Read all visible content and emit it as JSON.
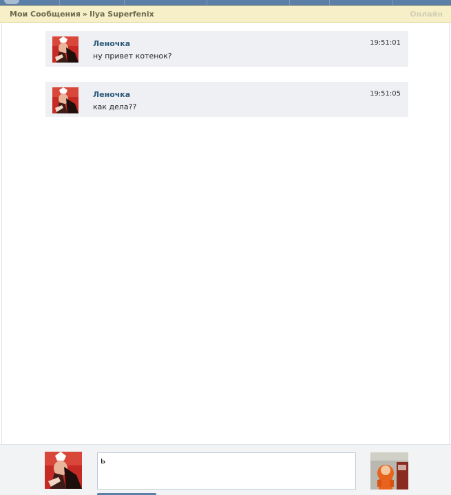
{
  "header": {
    "breadcrumb_root": "Мои Сообщения",
    "breadcrumb_separator": "»",
    "breadcrumb_current": "Ilya Superfenix",
    "status": "Онлайн"
  },
  "messages": [
    {
      "author": "Леночка",
      "time": "19:51:01",
      "text": "ну привет котенок?"
    },
    {
      "author": "Леночка",
      "time": "19:51:05",
      "text": "как дела??"
    }
  ],
  "composer": {
    "value": "ь"
  },
  "colors": {
    "header_bg": "#f7efc8",
    "author_link": "#2b587a",
    "message_bg": "#eef0f3",
    "top_strip": "#5b7fa6"
  },
  "icons": {
    "sender_avatar": "user-avatar-photo",
    "peer_avatar": "peer-avatar-photo"
  }
}
